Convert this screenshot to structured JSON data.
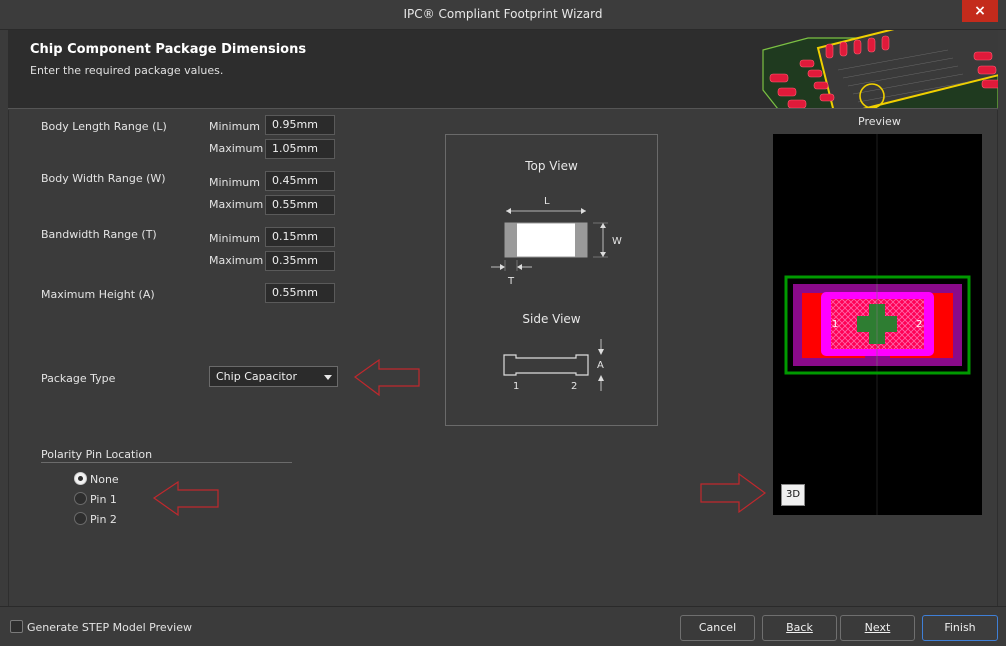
{
  "window": {
    "title": "IPC® Compliant Footprint Wizard",
    "close_glyph": "×"
  },
  "header": {
    "title": "Chip Component Package Dimensions",
    "subtitle": "Enter the required package values."
  },
  "dimensions": {
    "body_length": {
      "label": "Body Length Range (L)",
      "min_label": "Minimum",
      "min": "0.95mm",
      "max_label": "Maximum",
      "max": "1.05mm"
    },
    "body_width": {
      "label": "Body Width Range (W)",
      "min_label": "Minimum",
      "min": "0.45mm",
      "max_label": "Maximum",
      "max": "0.55mm"
    },
    "bandwidth": {
      "label": "Bandwidth Range (T)",
      "min_label": "Minimum",
      "min": "0.15mm",
      "max_label": "Maximum",
      "max": "0.35mm"
    },
    "max_height": {
      "label": "Maximum Height (A)",
      "value": "0.55mm"
    }
  },
  "package_type": {
    "label": "Package Type",
    "selected": "Chip Capacitor"
  },
  "polarity": {
    "title": "Polarity Pin Location",
    "options": [
      {
        "label": "None",
        "checked": true
      },
      {
        "label": "Pin 1",
        "checked": false
      },
      {
        "label": "Pin 2",
        "checked": false
      }
    ]
  },
  "diagram": {
    "top_view_title": "Top View",
    "side_view_title": "Side View",
    "dim_L": "L",
    "dim_W": "W",
    "dim_T": "T",
    "dim_A": "A",
    "pin1": "1",
    "pin2": "2"
  },
  "preview": {
    "label": "Preview",
    "btn_3d": "3D",
    "pad1_label": "1",
    "pad2_label": "2"
  },
  "footer": {
    "step_label": "Generate STEP Model Preview",
    "cancel": "Cancel",
    "back": "Back",
    "next": "Next",
    "finish": "Finish"
  },
  "colors": {
    "accent_button_border": "#3f7fd6",
    "close_red": "#c42b1c",
    "annotation_arrow": "#c0282d",
    "pad_red": "#ff0000",
    "body_magenta": "#ff00ff",
    "courtyard_green": "#009900",
    "assembly_purple": "#8a0a8a"
  },
  "icons": [
    "close-icon",
    "dropdown-chevron-icon",
    "arrow-annotation-icon"
  ]
}
